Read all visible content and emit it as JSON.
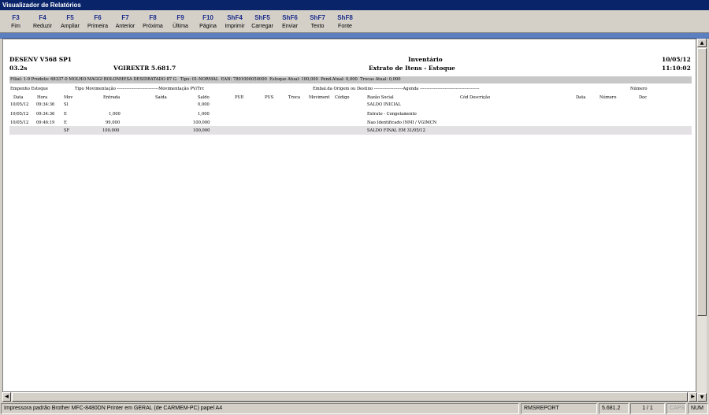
{
  "window": {
    "title": "Visualizador de Relatórios"
  },
  "toolbar": [
    {
      "key": "F3",
      "label": "Fim"
    },
    {
      "key": "F4",
      "label": "Reduzir"
    },
    {
      "key": "F5",
      "label": "Ampliar"
    },
    {
      "key": "F6",
      "label": "Primeira"
    },
    {
      "key": "F7",
      "label": "Anterior"
    },
    {
      "key": "F8",
      "label": "Próxima"
    },
    {
      "key": "F9",
      "label": "Última"
    },
    {
      "key": "F10",
      "label": "Página"
    },
    {
      "key": "ShF4",
      "label": "Imprimir"
    },
    {
      "key": "ShF5",
      "label": "Carregar"
    },
    {
      "key": "ShF6",
      "label": "Enviar"
    },
    {
      "key": "ShF7",
      "label": "Texto"
    },
    {
      "key": "ShF8",
      "label": "Fonte"
    }
  ],
  "report": {
    "system": "DESENV V568 SP1",
    "version_short": "03.2s",
    "program": "VGIREXTR 5.681.7",
    "title": "Inventário",
    "subtitle": "Extrato de Itens - Estoque",
    "date": "10/05/12",
    "time": "11:10:02",
    "filter_line": "Filial: 1-9 Produto: 68337-0 MOLHO MAGGI BOLONHESA DESIDRATADO 87 G   Tipo: 01-NORMAL  EAN: 7891000050000  Estoque Atual: 100,000  Pend.Atual: 0,000  Trocas Atual: 0,000",
    "header1": [
      {
        "text": "Empenho Estoque",
        "col": "c0"
      },
      {
        "text": "Tipo Movimentação ------------------------------Movimentação PV/Trc",
        "col": "c1"
      },
      {
        "text": "Embal.da Origem ou Destino ---------------------Agenda -------------------------------------------",
        "col": "c2"
      },
      {
        "text": "Número",
        "col": "c3"
      }
    ],
    "header2": [
      {
        "text": "Data",
        "col": "h_data"
      },
      {
        "text": "Hora",
        "col": "h_hora"
      },
      {
        "text": "Mov",
        "col": "h_mov"
      },
      {
        "text": "Entrada",
        "col": "h_ent"
      },
      {
        "text": "Saída",
        "col": "h_sai"
      },
      {
        "text": "Saldo",
        "col": "h_sal"
      },
      {
        "text": "PUE",
        "col": "h_pue"
      },
      {
        "text": "PUS",
        "col": "h_pus"
      },
      {
        "text": "Troca",
        "col": "h_troca"
      },
      {
        "text": "Moviment",
        "col": "h_movi"
      },
      {
        "text": "Código",
        "col": "h_cod"
      },
      {
        "text": "Razão Social",
        "col": "h_razao"
      },
      {
        "text": "Cód Descrição",
        "col": "h_cdesc"
      },
      {
        "text": "Data",
        "col": "h_data2"
      },
      {
        "text": "Número",
        "col": "h_num"
      },
      {
        "text": "Doc",
        "col": "h_doc"
      }
    ],
    "rows": [
      {
        "data": "10/05/12",
        "hora": "09:34:36",
        "mov": "SI",
        "entrada": "",
        "saida": "",
        "saldo": "0,000",
        "razao": "SALDO INICIAL"
      },
      {
        "data": "10/05/12",
        "hora": "09:34:36",
        "mov": "E",
        "entrada": "1,000",
        "saida": "",
        "saldo": "1,000",
        "razao": "Extrato - Congelamento"
      },
      {
        "data": "10/05/12",
        "hora": "09:46:19",
        "mov": "E",
        "entrada": "99,000",
        "saida": "",
        "saldo": "100,000",
        "razao": "Nao Identificado (NMI / VGIMCN"
      },
      {
        "data": "",
        "hora": "",
        "mov": "SF",
        "entrada": "100,000",
        "saida": "",
        "saldo": "100,000",
        "razao": "SALDO FINAL EM 31/05/12"
      }
    ]
  },
  "status": {
    "printer": "Impressora padrão Brother MFC-8480DN Printer em GERAL (de CARMEM-PC) papel A4",
    "module": "RMSREPORT",
    "version": "5.681.2",
    "page": "1 / 1",
    "caps": "CAPS",
    "num": "NUM"
  }
}
